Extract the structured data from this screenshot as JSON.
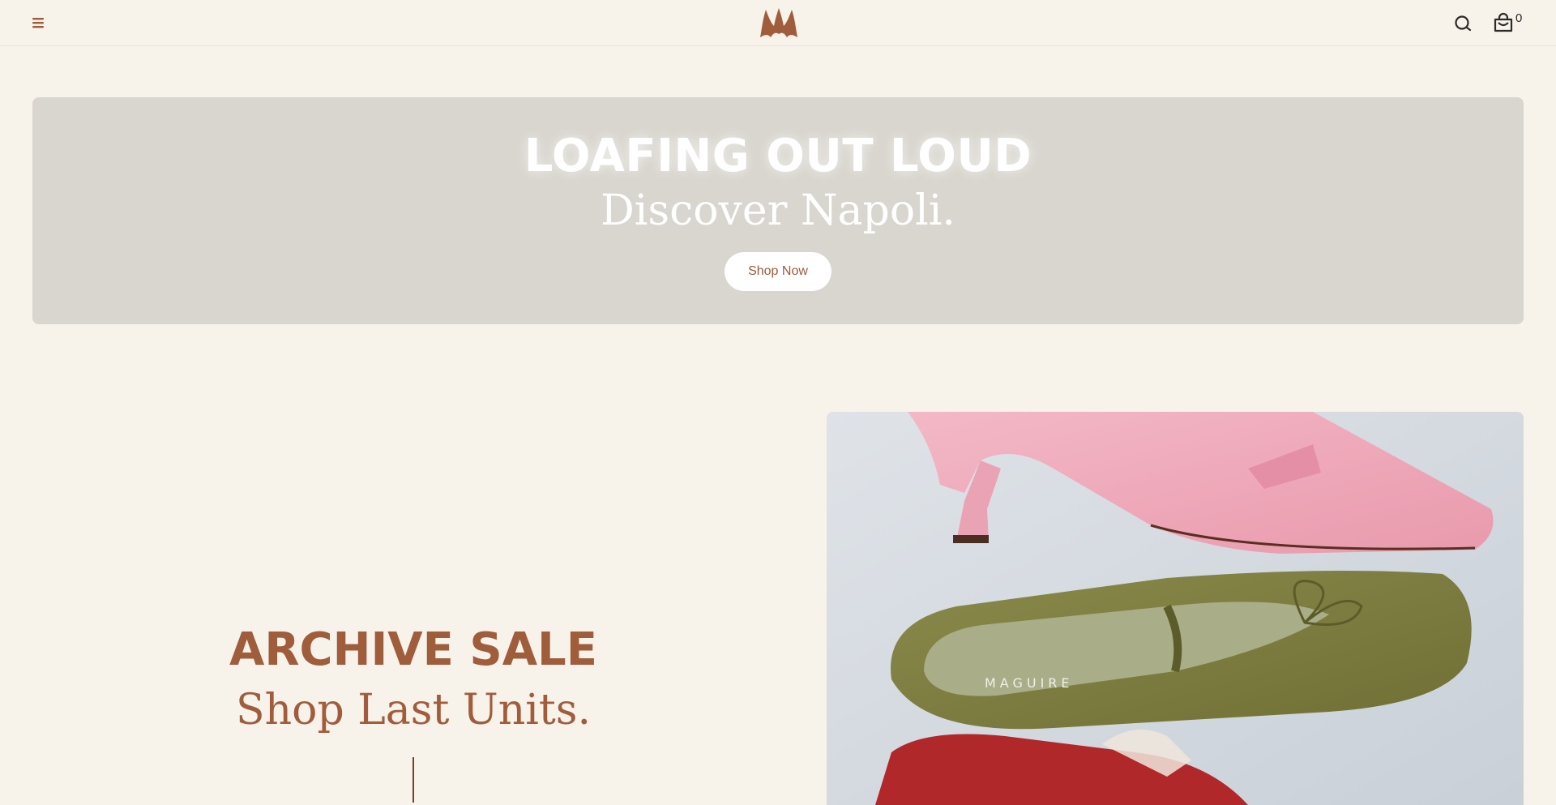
{
  "header": {
    "menu_icon": "hamburger-menu-icon",
    "logo": "brand-logo",
    "search_icon": "search-icon",
    "cart_icon": "shopping-bag-icon",
    "cart_count": "0"
  },
  "hero": {
    "title": "LOAFING OUT LOUD",
    "subtitle": "Discover Napoli.",
    "button_label": "Shop Now"
  },
  "promo": {
    "title": "ARCHIVE SALE",
    "subtitle": "Shop Last Units.",
    "image_brand_text": "MAGUIRE"
  },
  "colors": {
    "background": "#f7f2ea",
    "accent": "#a05d3c",
    "hero_bg": "#d9d6cf"
  }
}
